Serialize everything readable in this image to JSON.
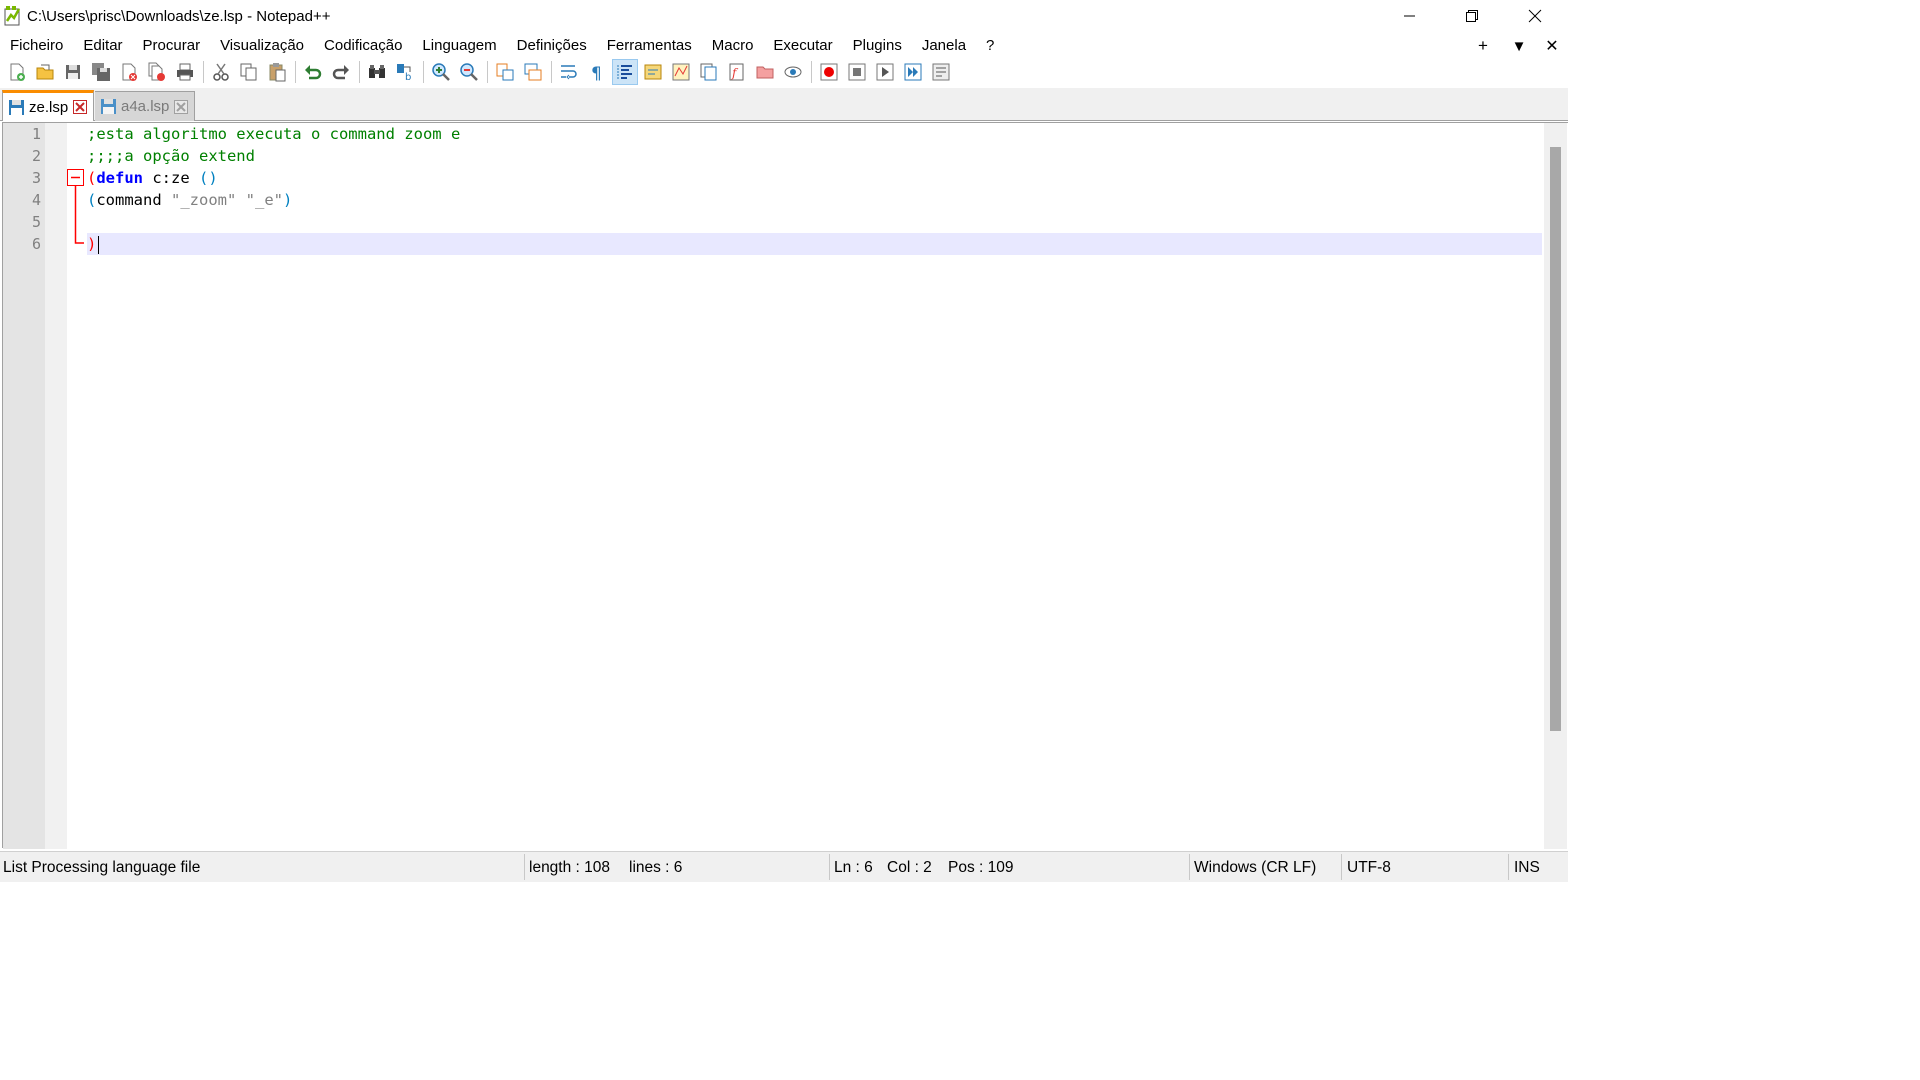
{
  "window": {
    "title": "C:\\Users\\prisc\\Downloads\\ze.lsp - Notepad++",
    "controls": {
      "minimize": "minimize-icon",
      "restore": "restore-icon",
      "close": "close-icon"
    }
  },
  "menu": {
    "items": [
      "Ficheiro",
      "Editar",
      "Procurar",
      "Visualização",
      "Codificação",
      "Linguagem",
      "Definições",
      "Ferramentas",
      "Macro",
      "Executar",
      "Plugins",
      "Janela",
      "?"
    ],
    "right": {
      "plus": "+",
      "dropdown": "▼",
      "close": "✕"
    }
  },
  "tabs": [
    {
      "label": "ze.lsp",
      "active": true
    },
    {
      "label": "a4a.lsp",
      "active": false
    }
  ],
  "editor": {
    "line_numbers": [
      "1",
      "2",
      "3",
      "4",
      "5",
      "6"
    ],
    "lines": {
      "l1": ";esta algoritmo executa o command zoom e",
      "l2": ";;;;a opção extend",
      "l3_open": "(",
      "l3_kw": "defun",
      "l3_name": " c:ze ",
      "l3_args": "()",
      "l4_open": "(",
      "l4_cmd": "command ",
      "l4_str1": "\"_zoom\"",
      "l4_space": " ",
      "l4_str2": "\"_e\"",
      "l4_close": ")",
      "l6_close": ")"
    },
    "current_line": 6
  },
  "status": {
    "filetype": "List Processing language file",
    "length": "length : 108",
    "lines": "lines : 6",
    "ln": "Ln : 6",
    "col": "Col : 2",
    "pos": "Pos : 109",
    "eol": "Windows (CR LF)",
    "encoding": "UTF-8",
    "mode": "INS"
  },
  "colors": {
    "comment": "#008000",
    "keyword": "#0000ff",
    "paren": "#0080c0",
    "paren_match": "#ff0000",
    "string": "#808080",
    "active_tab_accent": "#fa8c00",
    "current_line": "#e8e8ff"
  },
  "toolbar_icons": [
    "new-file-icon",
    "open-file-icon",
    "save-icon",
    "save-all-icon",
    "close-icon",
    "close-all-icon",
    "print-icon",
    "cut-icon",
    "copy-icon",
    "paste-icon",
    "undo-icon",
    "redo-icon",
    "find-icon",
    "replace-icon",
    "zoom-in-icon",
    "zoom-out-icon",
    "sync-vertical-icon",
    "sync-horizontal-icon",
    "word-wrap-icon",
    "show-all-chars-icon",
    "indent-guide-icon",
    "udl-icon",
    "doc-map-icon",
    "doc-list-icon",
    "function-list-icon",
    "folder-workspace-icon",
    "monitoring-icon",
    "record-macro-icon",
    "stop-macro-icon",
    "play-macro-icon",
    "run-macro-multiple-icon",
    "save-macro-icon"
  ]
}
